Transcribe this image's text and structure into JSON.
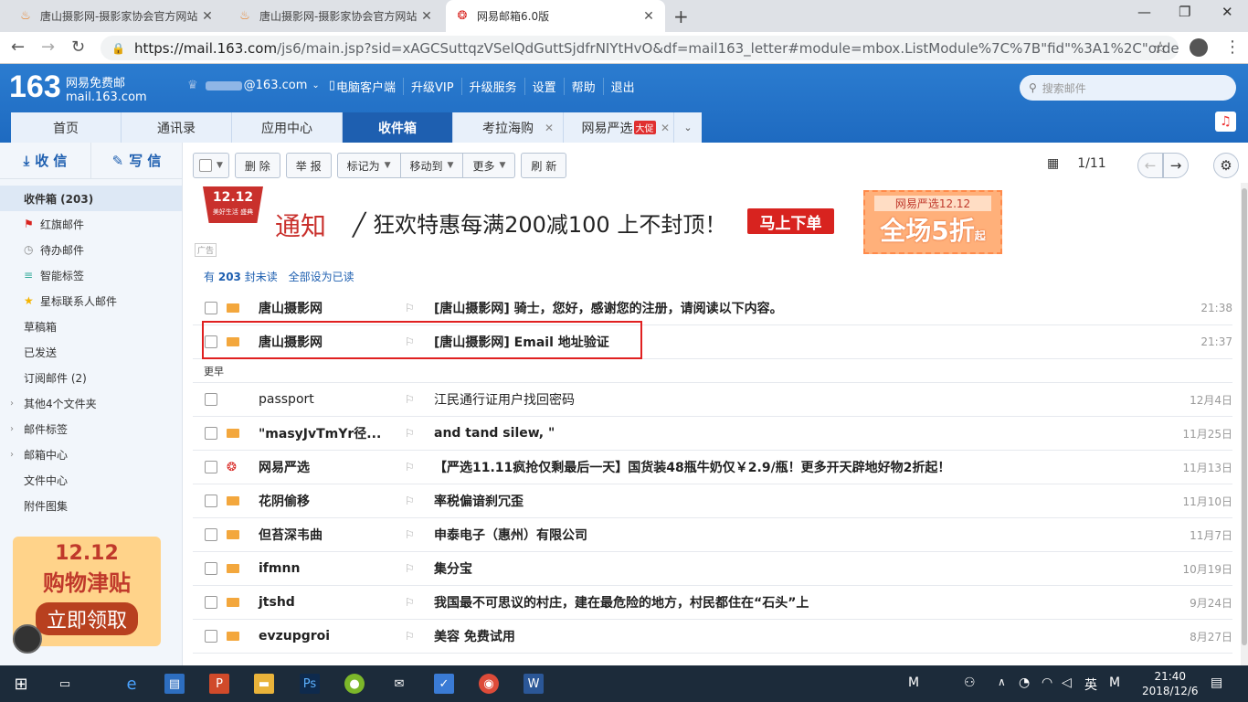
{
  "browser": {
    "tabs": [
      {
        "title": "唐山摄影网-摄影家协会官方网站",
        "close": "✕"
      },
      {
        "title": "唐山摄影网-摄影家协会官方网站",
        "close": "✕"
      },
      {
        "title": "网易邮箱6.0版",
        "close": "✕"
      }
    ],
    "new_tab": "+",
    "url_host": "https://mail.163.com",
    "url_rest": "/js6/main.jsp?sid=xAGCSuttqzVSelQdGuttSjdfrNIYtHvO&df=mail163_letter#module=mbox.ListModule%7C%7B\"fid\"%3A1%2C\"order\"%3A\"dat..."
  },
  "header": {
    "logo": "163",
    "logo_line1": "网易免费邮",
    "logo_line2": "mail.163.com",
    "user_suffix": "@163.com",
    "nav": [
      "电脑客户端",
      "升级VIP",
      "升级服务",
      "设置",
      "帮助",
      "退出"
    ],
    "search_placeholder": "搜索邮件",
    "tabs": [
      "首页",
      "通讯录",
      "应用中心",
      "收件箱",
      "考拉海购",
      "网易严选"
    ],
    "promo_badge": "大促"
  },
  "sidebar": {
    "receive": "收 信",
    "compose": "写 信",
    "folders": [
      {
        "label": "收件箱 (203)",
        "icon": ""
      },
      {
        "label": "红旗邮件",
        "icon": "⚑"
      },
      {
        "label": "待办邮件",
        "icon": "◷"
      },
      {
        "label": "智能标签",
        "icon": "≡"
      },
      {
        "label": "星标联系人邮件",
        "icon": "★"
      },
      {
        "label": "草稿箱",
        "icon": ""
      },
      {
        "label": "已发送",
        "icon": ""
      },
      {
        "label": "订阅邮件 (2)",
        "icon": ""
      },
      {
        "label": "其他4个文件夹",
        "icon": ""
      },
      {
        "label": "邮件标签",
        "icon": ""
      },
      {
        "label": "邮箱中心",
        "icon": ""
      },
      {
        "label": "文件中心",
        "icon": ""
      },
      {
        "label": "附件图集",
        "icon": ""
      }
    ],
    "promo_line1": "12.12",
    "promo_line2": "购物津贴",
    "promo_cta": "立即领取"
  },
  "toolbar": {
    "delete": "删 除",
    "report": "举 报",
    "mark_as": "标记为",
    "move_to": "移动到",
    "more": "更多",
    "refresh": "刷 新",
    "page": "1/11"
  },
  "ad": {
    "badge": "12.12",
    "badge_sub": "美好生活 盛典",
    "label": "广告",
    "title1": "通知",
    "title2": "╱ 狂欢特惠每满200减100 上不封顶！",
    "cta": "马上下单",
    "coupon_top": "网易严选12.12",
    "coupon_main": "全场5折",
    "coupon_suffix": "起"
  },
  "unread": {
    "prefix": "有",
    "count": "203",
    "suffix": "封未读",
    "mark_all": "全部设为已读"
  },
  "emails": [
    {
      "sender": "唐山摄影网",
      "subject": "[唐山摄影网] 骑士，您好，感谢您的注册，请阅读以下内容。",
      "time": "21:38"
    },
    {
      "sender": "唐山摄影网",
      "subject": "[唐山摄影网] Email 地址验证",
      "time": "21:37"
    }
  ],
  "separator": "更早",
  "emails_earlier": [
    {
      "sender": "passport",
      "subject": "江民通行证用户找回密码",
      "time": "12月4日"
    },
    {
      "sender": "\"masyJvTmYr径...",
      "subject": "and tand silew, \"",
      "time": "11月25日"
    },
    {
      "sender": "网易严选",
      "subject": "【严选11.11疯抢仅剩最后一天】国货装48瓶牛奶仅￥2.9/瓶！更多开天辟地好物2折起！",
      "time": "11月13日"
    },
    {
      "sender": "花阴偷移",
      "subject": "率税偏谙刹冗歪",
      "time": "11月10日"
    },
    {
      "sender": "但苔深韦曲",
      "subject": "申泰电子（惠州）有限公司",
      "time": "11月7日"
    },
    {
      "sender": "ifmnn",
      "subject": "集分宝",
      "time": "10月19日"
    },
    {
      "sender": "jtshd",
      "subject": "我国最不可思议的村庄，建在最危险的地方，村民都住在“石头”上",
      "time": "9月24日"
    },
    {
      "sender": "evzupgroi",
      "subject": "美容 免费试用",
      "time": "8月27日"
    }
  ],
  "taskbar": {
    "ime": "英",
    "time": "21:40",
    "date": "2018/12/6"
  }
}
